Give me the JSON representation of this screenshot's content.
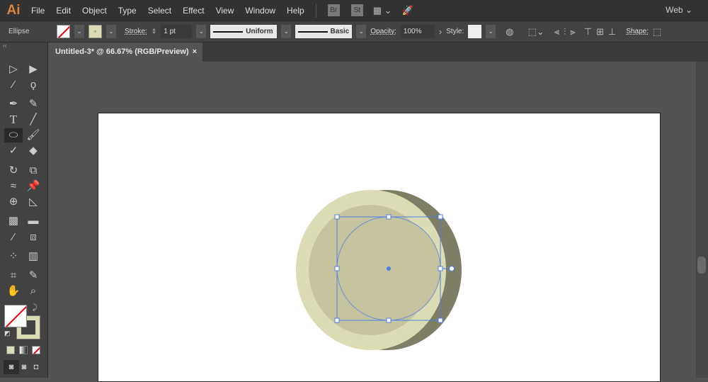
{
  "app": {
    "logo": "Ai",
    "menus": [
      "File",
      "Edit",
      "Object",
      "Type",
      "Select",
      "Effect",
      "View",
      "Window",
      "Help"
    ],
    "bridge": "Br",
    "stock": "St",
    "workspace": "Web"
  },
  "control": {
    "object_type": "Ellipse",
    "stroke_label": "Stroke:",
    "stroke_weight": "1 pt",
    "profile": "Uniform",
    "brush": "Basic",
    "opacity_label": "Opacity:",
    "opacity": "100%",
    "style_label": "Style:",
    "shape_label": "Shape:",
    "fill_color": "#dcdcb4"
  },
  "document": {
    "tab_title": "Untitled-3* @ 66.67% (RGB/Preview)",
    "close": "×"
  },
  "colors": {
    "outer": "#dcdcb4",
    "shadow": "#7e7e66",
    "inner": "#c5c49f",
    "selection": "#4f7fe0"
  },
  "tools": [
    "selection",
    "direct-selection",
    "magic-wand",
    "lasso",
    "pen",
    "curvature",
    "type",
    "line",
    "ellipse",
    "paintbrush",
    "shaper",
    "eraser",
    "rotate",
    "scale",
    "warp",
    "puppet-warp",
    "shape-builder",
    "perspective-grid",
    "mesh",
    "gradient",
    "eyedropper",
    "blend",
    "symbol-sprayer",
    "column-graph",
    "artboard",
    "slice",
    "hand",
    "zoom"
  ]
}
